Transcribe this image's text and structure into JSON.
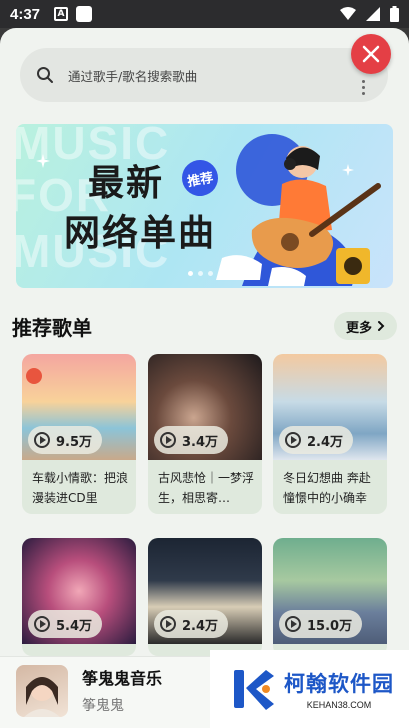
{
  "status_bar": {
    "time": "4:37",
    "notif_icon_letter": "A"
  },
  "search": {
    "placeholder": "通过歌手/歌名搜索歌曲"
  },
  "banner": {
    "title_line1": "最新",
    "title_line2": "网络单曲",
    "tag": "推荐",
    "bg_words": [
      "MUSIC",
      "FOR",
      "MUSIC"
    ]
  },
  "section": {
    "title": "推荐歌单",
    "more_label": "更多"
  },
  "playlists": [
    {
      "plays": "9.5万",
      "name": "车载小情歌：把浪漫装进CD里"
    },
    {
      "plays": "3.4万",
      "name": "古风悲怆｜一梦浮生，相思寄…"
    },
    {
      "plays": "2.4万",
      "name": "冬日幻想曲 奔赴憧憬中的小确幸"
    },
    {
      "plays": "5.4万",
      "name": ""
    },
    {
      "plays": "2.4万",
      "name": ""
    },
    {
      "plays": "15.0万",
      "name": ""
    }
  ],
  "player": {
    "title": "筝鬼鬼音乐",
    "artist": "筝鬼鬼"
  },
  "watermark": {
    "main": "柯翰软件园",
    "sub": "KEHAN38.COM"
  },
  "colors": {
    "accent_red": "#e43f45",
    "card_bg": "#dfe9dd",
    "page_bg": "#f0f3ef",
    "watermark_blue": "#1d57c7"
  }
}
